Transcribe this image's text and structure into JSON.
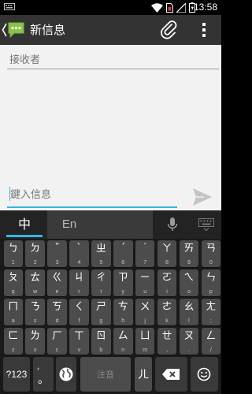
{
  "status_bar": {
    "time": "13:58",
    "icons": [
      "keyboard-icon",
      "wifi-icon",
      "sim-icon",
      "signal-icon",
      "battery-icon"
    ]
  },
  "action_bar": {
    "title": "新信息",
    "icons": [
      "back-chevron-icon",
      "messaging-app-icon",
      "attach-icon",
      "overflow-menu-icon"
    ]
  },
  "compose": {
    "recipient_placeholder": "接收者",
    "message_placeholder": "鍵入信息",
    "send_icon": "send-icon"
  },
  "keyboard": {
    "mode_chinese": "中",
    "mode_english": "En",
    "top_icons": [
      "microphone-icon",
      "hide-keyboard-icon"
    ],
    "rows": [
      [
        {
          "sym": "ㄅ",
          "hint": "1"
        },
        {
          "sym": "ㄉ",
          "hint": "2"
        },
        {
          "sym": "ˇ",
          "hint": "3"
        },
        {
          "sym": "ˋ",
          "hint": "4"
        },
        {
          "sym": "ㄓ",
          "hint": "5"
        },
        {
          "sym": "ˊ",
          "hint": "6"
        },
        {
          "sym": "˙",
          "hint": "7"
        },
        {
          "sym": "ㄚ",
          "hint": "8"
        },
        {
          "sym": "ㄞ",
          "hint": "9"
        },
        {
          "sym": "ㄢ",
          "hint": "0"
        }
      ],
      [
        {
          "sym": "ㄆ",
          "hint": "q"
        },
        {
          "sym": "ㄊ",
          "hint": "w"
        },
        {
          "sym": "ㄍ",
          "hint": "e"
        },
        {
          "sym": "ㄐ",
          "hint": "r"
        },
        {
          "sym": "ㄔ",
          "hint": "t"
        },
        {
          "sym": "ㄗ",
          "hint": "y"
        },
        {
          "sym": "ㄧ",
          "hint": "u"
        },
        {
          "sym": "ㄛ",
          "hint": "i"
        },
        {
          "sym": "ㄟ",
          "hint": "o"
        },
        {
          "sym": "ㄣ",
          "hint": "p"
        }
      ],
      [
        {
          "sym": "ㄇ",
          "hint": "a"
        },
        {
          "sym": "ㄋ",
          "hint": "s"
        },
        {
          "sym": "ㄎ",
          "hint": "d"
        },
        {
          "sym": "ㄑ",
          "hint": "f"
        },
        {
          "sym": "ㄕ",
          "hint": "g"
        },
        {
          "sym": "ㄘ",
          "hint": "h"
        },
        {
          "sym": "ㄨ",
          "hint": "j"
        },
        {
          "sym": "ㄜ",
          "hint": "k"
        },
        {
          "sym": "ㄠ",
          "hint": "l"
        },
        {
          "sym": "ㄤ",
          "hint": ";"
        }
      ],
      [
        {
          "sym": "ㄈ",
          "hint": "z"
        },
        {
          "sym": "ㄌ",
          "hint": "x"
        },
        {
          "sym": "ㄏ",
          "hint": "c"
        },
        {
          "sym": "ㄒ",
          "hint": "v"
        },
        {
          "sym": "ㄖ",
          "hint": "b"
        },
        {
          "sym": "ㄙ",
          "hint": "n"
        },
        {
          "sym": "ㄩ",
          "hint": "m"
        },
        {
          "sym": "ㄝ",
          "hint": ","
        },
        {
          "sym": "ㄡ",
          "hint": "."
        },
        {
          "sym": "ㄥ",
          "hint": "/"
        }
      ]
    ],
    "bottom_row": {
      "symbols_label": "?123",
      "comma_label": "，",
      "period_label": "。",
      "globe_icon": "globe-icon",
      "space_label": "注音",
      "er_label": "ㄦ",
      "delete_icon": "backspace-icon",
      "emoji_icon": "emoji-icon"
    }
  }
}
